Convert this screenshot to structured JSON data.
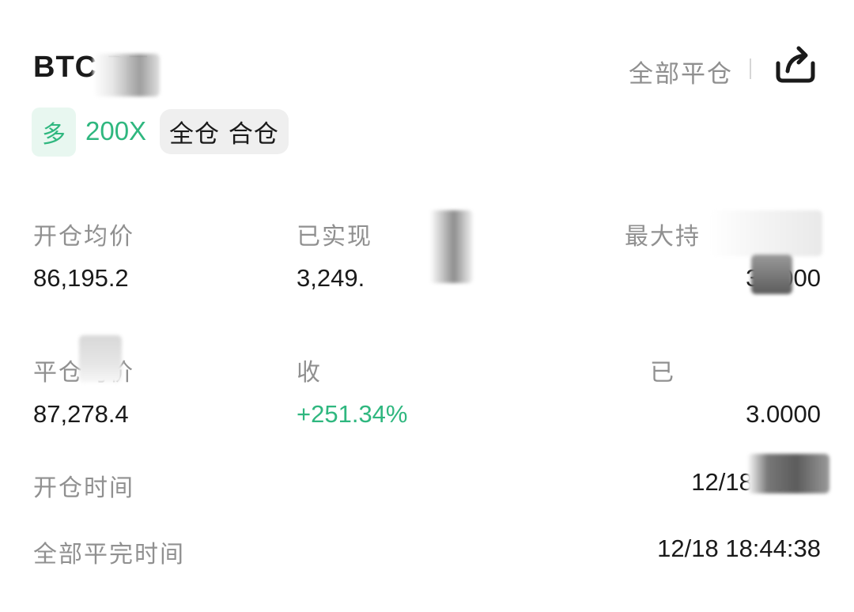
{
  "header": {
    "symbol": "BTC   DT",
    "close_all_label": "全部平仓",
    "share_icon": "share-icon"
  },
  "tags": {
    "side": "多",
    "leverage": "200X",
    "margin_mode": "全仓 合仓"
  },
  "stats": {
    "avg_open_price_label": "开仓均价",
    "avg_open_price_value": "86,195.2",
    "realized_pnl_label": "已实现",
    "realized_pnl_value": "3,249.",
    "max_position_label": "最大持",
    "max_position_value": "3.0000",
    "avg_close_price_label": "平仓均价",
    "avg_close_price_value": "87,278.4",
    "roi_label": "收",
    "roi_value": "+251.34%",
    "closed_amount_label": "已",
    "closed_amount_value": "3.0000"
  },
  "times": {
    "open_time_label": "开仓时间",
    "open_time_value": "12/18 00:42",
    "close_time_label": "全部平完时间",
    "close_time_value": "12/18 18:44:38"
  },
  "colors": {
    "accent_green": "#2fb77f",
    "label_gray": "#909090",
    "badge_green_bg": "#e8f7f0",
    "badge_gray_bg": "#efefef"
  }
}
